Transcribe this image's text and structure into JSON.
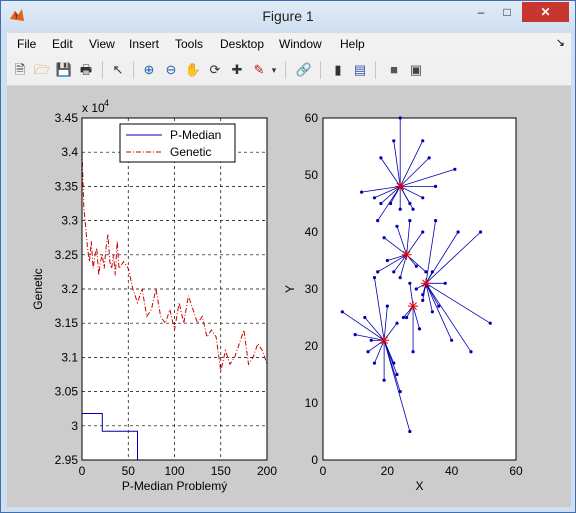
{
  "window": {
    "title": "Figure 1",
    "minimize": "–",
    "maximize": "□",
    "close": "✕"
  },
  "menu": [
    "File",
    "Edit",
    "View",
    "Insert",
    "Tools",
    "Desktop",
    "Window",
    "Help"
  ],
  "toolbar_icons": [
    "new-figure-icon",
    "open-icon",
    "save-icon",
    "print-icon",
    "pointer-icon",
    "zoom-in-icon",
    "zoom-out-icon",
    "pan-icon",
    "rotate-icon",
    "data-cursor-icon",
    "brush-icon",
    "brush-dropdown-icon",
    "link-icon",
    "colorbar-icon",
    "legend-icon",
    "hide-tools-icon",
    "show-tools-icon"
  ],
  "chart_data": [
    {
      "type": "line",
      "xlabel": "P-Median Problemý",
      "ylabel": "Genetic",
      "y_exponent": "x 10",
      "y_exponent_power": "4",
      "xlim": [
        0,
        200
      ],
      "ylim": [
        29500,
        34500
      ],
      "xticks": [
        "0",
        "50",
        "100",
        "150",
        "200"
      ],
      "yticks": [
        "2.95",
        "3",
        "3.05",
        "3.1",
        "3.15",
        "3.2",
        "3.25",
        "3.3",
        "3.35",
        "3.4",
        "3.45"
      ],
      "grid": true,
      "legend_position": "top",
      "series": [
        {
          "name": "P-Median",
          "color": "#0000b0",
          "style": "solid",
          "x": [
            0,
            22,
            22,
            60,
            60,
            200
          ],
          "y": [
            30180,
            30180,
            29920,
            29920,
            29500,
            29500
          ]
        },
        {
          "name": "Genetic",
          "color": "#cc0000",
          "style": "dashdot",
          "x": [
            0,
            2,
            4,
            6,
            8,
            10,
            12,
            14,
            16,
            18,
            20,
            22,
            24,
            26,
            28,
            30,
            32,
            34,
            36,
            38,
            40,
            45,
            50,
            55,
            60,
            65,
            70,
            75,
            80,
            85,
            90,
            95,
            100,
            105,
            110,
            115,
            120,
            125,
            130,
            135,
            140,
            145,
            150,
            155,
            160,
            165,
            170,
            175,
            180,
            185,
            190,
            195,
            200
          ],
          "y": [
            34000,
            33200,
            32900,
            32600,
            32400,
            32700,
            32300,
            32500,
            32600,
            32200,
            32400,
            32500,
            32300,
            32600,
            32800,
            32400,
            32300,
            32500,
            32200,
            32700,
            32300,
            32400,
            32300,
            32000,
            31800,
            32000,
            31600,
            31700,
            32000,
            31600,
            31500,
            31700,
            31400,
            31800,
            31500,
            31900,
            31700,
            31500,
            31600,
            31300,
            31400,
            31300,
            30800,
            31100,
            30900,
            31000,
            31200,
            31400,
            30900,
            31000,
            31200,
            31100,
            30900
          ]
        }
      ]
    },
    {
      "type": "scatter",
      "xlabel": "X",
      "ylabel": "Y",
      "xlim": [
        0,
        60
      ],
      "ylim": [
        0,
        60
      ],
      "xticks": [
        "0",
        "20",
        "40",
        "60"
      ],
      "yticks": [
        "0",
        "10",
        "20",
        "30",
        "40",
        "50",
        "60"
      ],
      "grid": false,
      "centers": [
        {
          "x": 24,
          "y": 48,
          "points": [
            [
              24,
              60
            ],
            [
              18,
              53
            ],
            [
              22,
              56
            ],
            [
              31,
              56
            ],
            [
              33,
              53
            ],
            [
              41,
              51
            ],
            [
              35,
              48
            ],
            [
              31,
              46
            ],
            [
              28,
              44
            ],
            [
              12,
              47
            ],
            [
              16,
              46
            ],
            [
              18,
              45
            ],
            [
              17,
              42
            ],
            [
              21,
              45
            ],
            [
              24,
              44
            ],
            [
              27,
              45
            ]
          ]
        },
        {
          "x": 26,
          "y": 36,
          "points": [
            [
              19,
              39
            ],
            [
              23,
              41
            ],
            [
              27,
              42
            ],
            [
              31,
              40
            ],
            [
              20,
              35
            ],
            [
              17,
              33
            ],
            [
              22,
              33
            ],
            [
              29,
              34
            ],
            [
              24,
              32
            ],
            [
              32,
              33
            ]
          ]
        },
        {
          "x": 32,
          "y": 31,
          "points": [
            [
              35,
              42
            ],
            [
              42,
              40
            ],
            [
              49,
              40
            ],
            [
              52,
              24
            ],
            [
              46,
              19
            ],
            [
              40,
              21
            ],
            [
              34,
              26
            ],
            [
              36,
              27
            ],
            [
              31,
              28
            ],
            [
              29,
              30
            ],
            [
              31,
              29
            ],
            [
              34,
              33
            ],
            [
              38,
              31
            ]
          ]
        },
        {
          "x": 28,
          "y": 27,
          "points": [
            [
              26,
              25
            ],
            [
              27,
              31
            ],
            [
              30,
              23
            ],
            [
              28,
              19
            ],
            [
              25,
              25
            ]
          ]
        },
        {
          "x": 19,
          "y": 21,
          "points": [
            [
              6,
              26
            ],
            [
              10,
              22
            ],
            [
              13,
              25
            ],
            [
              16,
              32
            ],
            [
              14,
              19
            ],
            [
              19,
              14
            ],
            [
              16,
              17
            ],
            [
              15,
              21
            ],
            [
              20,
              27
            ],
            [
              23,
              24
            ],
            [
              24,
              12
            ],
            [
              23,
              15
            ],
            [
              27,
              5
            ],
            [
              22,
              17
            ]
          ]
        }
      ]
    }
  ]
}
